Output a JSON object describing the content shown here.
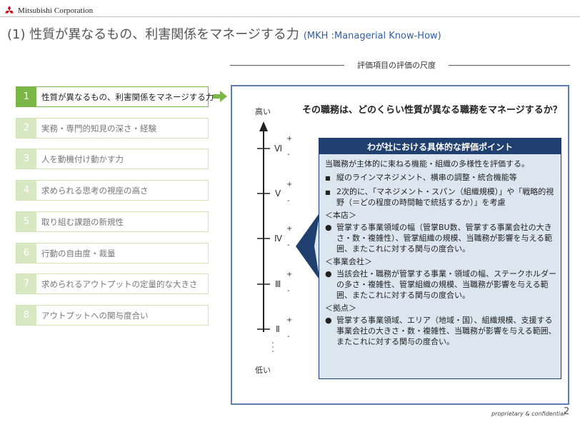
{
  "header": {
    "company": "Mitsubishi Corporation",
    "title": "(1) 性質が異なるもの、利害関係をマネージする力",
    "subtitle": "(MKH :Managerial Know-How)"
  },
  "scale_heading": "評価項目の評価の尺度",
  "items": [
    {
      "num": "1",
      "label": "性質が異なるもの、利害関係をマネージする力",
      "active": true
    },
    {
      "num": "2",
      "label": "実務・専門的知見の深さ・経験",
      "active": false
    },
    {
      "num": "3",
      "label": "人を動機付け動かす力",
      "active": false
    },
    {
      "num": "4",
      "label": "求められる思考の視座の高さ",
      "active": false
    },
    {
      "num": "5",
      "label": "取り組む課題の新規性",
      "active": false
    },
    {
      "num": "6",
      "label": "行動の自由度・裁量",
      "active": false
    },
    {
      "num": "7",
      "label": "求められるアウトプットの定量的な大きさ",
      "active": false
    },
    {
      "num": "8",
      "label": "アウトプットへの関与度合い",
      "active": false
    }
  ],
  "main": {
    "question": "その職務は、どのくらい性質が異なる職務をマネージするか？",
    "axis_high": "高い",
    "axis_low": "低い",
    "plus": "+",
    "minus": "-",
    "levels": [
      "Ⅵ",
      "Ⅴ",
      "Ⅳ",
      "Ⅲ",
      "Ⅱ"
    ]
  },
  "detail": {
    "heading": "わが社における具体的な評価ポイント",
    "intro": "当職務が主体的に束ねる機能・組織の多様性を評価する。",
    "square_bullets": [
      "縦のラインマネジメント、横串の調整・統合機能等",
      "2次的に、「マネジメント・スパン（組織規模）」や「戦略的視野（＝どの程度の時間軸で統括するか）」を考慮"
    ],
    "sections": [
      {
        "title": "＜本店＞",
        "text": "管掌する事業領域の幅（管掌BU数、管掌する事業会社の大きさ・数・複雑性）、管掌組織の規模、当職務が影響を与える範囲、またこれに対する関与の度合い。"
      },
      {
        "title": "＜事業会社＞",
        "text": "当該会社・職務が管掌する事業・領域の幅、ステークホルダーの多さ・複雑性、管掌組織の規模、当職務が影響を与える範囲、またこれに対する関与の度合い。"
      },
      {
        "title": "＜拠点＞",
        "text": "管掌する事業領域、エリア（地域・国）、組織規模、支援する事業会社の大きさ・数・複雑性、当職務が影響を与える範囲、またこれに対する関与の度合い。"
      }
    ]
  },
  "footer": {
    "note": "proprietary & confidential",
    "page": "2"
  },
  "colors": {
    "accent_green": "#7ab648",
    "light_green": "#d8e8c2",
    "navy": "#1f3f6f",
    "panel_blue": "#dce6f1",
    "box_blue": "#5a7fb8",
    "brand_red": "#d7000f"
  }
}
